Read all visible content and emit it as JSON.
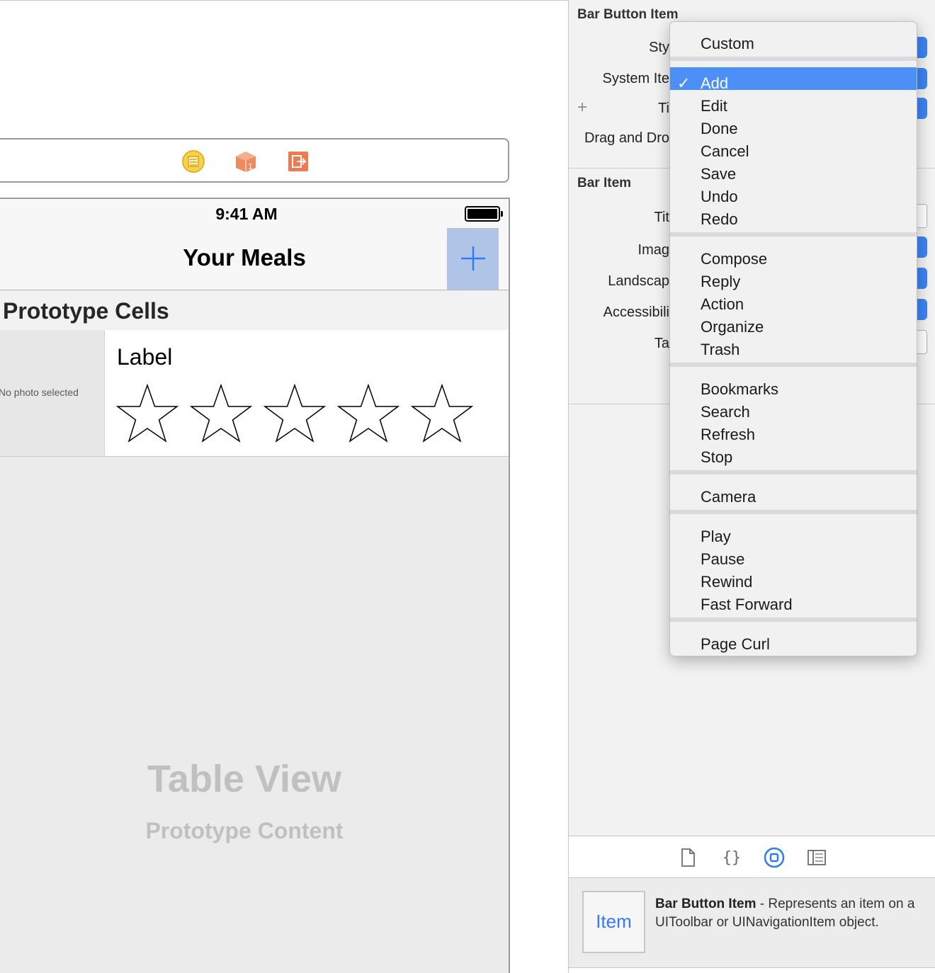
{
  "canvas": {
    "status_time": "9:41 AM",
    "nav_title": "Your Meals",
    "section_header": "Prototype Cells",
    "photo_placeholder": "No photo selected",
    "cell_label": "Label",
    "rating_stars": 5,
    "placeholder_title": "Table View",
    "placeholder_subtitle": "Prototype Content",
    "add_button_tint": "#afc4e6",
    "accent": "#2f7cf6",
    "dock_icons": [
      "view-controller-icon",
      "first-responder-icon",
      "exit-icon"
    ]
  },
  "inspector": {
    "bar_button_item": {
      "title": "Bar Button Item",
      "style_label": "Sty",
      "system_item_label": "System Ite",
      "title_label": "Ti",
      "drag_drop_label": "Drag and Dro"
    },
    "bar_item": {
      "title": "Bar Item",
      "title_label": "Tit",
      "image_label": "Imag",
      "landscape_label": "Landscap",
      "accessibility_label": "Accessibili",
      "tag_label": "Ta"
    },
    "tabs": [
      "file-inspector-icon",
      "quick-help-icon",
      "identity-inspector-icon",
      "attributes-inspector-icon"
    ],
    "help": {
      "thumb_label": "Item",
      "name": "Bar Button Item",
      "description": " - Represents an item on a UIToolbar or UINavigationItem object."
    }
  },
  "menu": {
    "selected": "Add",
    "check_mark": "✓",
    "groups": [
      [
        "Custom"
      ],
      [
        "Add",
        "Edit",
        "Done",
        "Cancel",
        "Save",
        "Undo",
        "Redo"
      ],
      [
        "Compose",
        "Reply",
        "Action",
        "Organize",
        "Trash"
      ],
      [
        "Bookmarks",
        "Search",
        "Refresh",
        "Stop"
      ],
      [
        "Camera"
      ],
      [
        "Play",
        "Pause",
        "Rewind",
        "Fast Forward"
      ],
      [
        "Page Curl"
      ]
    ]
  }
}
